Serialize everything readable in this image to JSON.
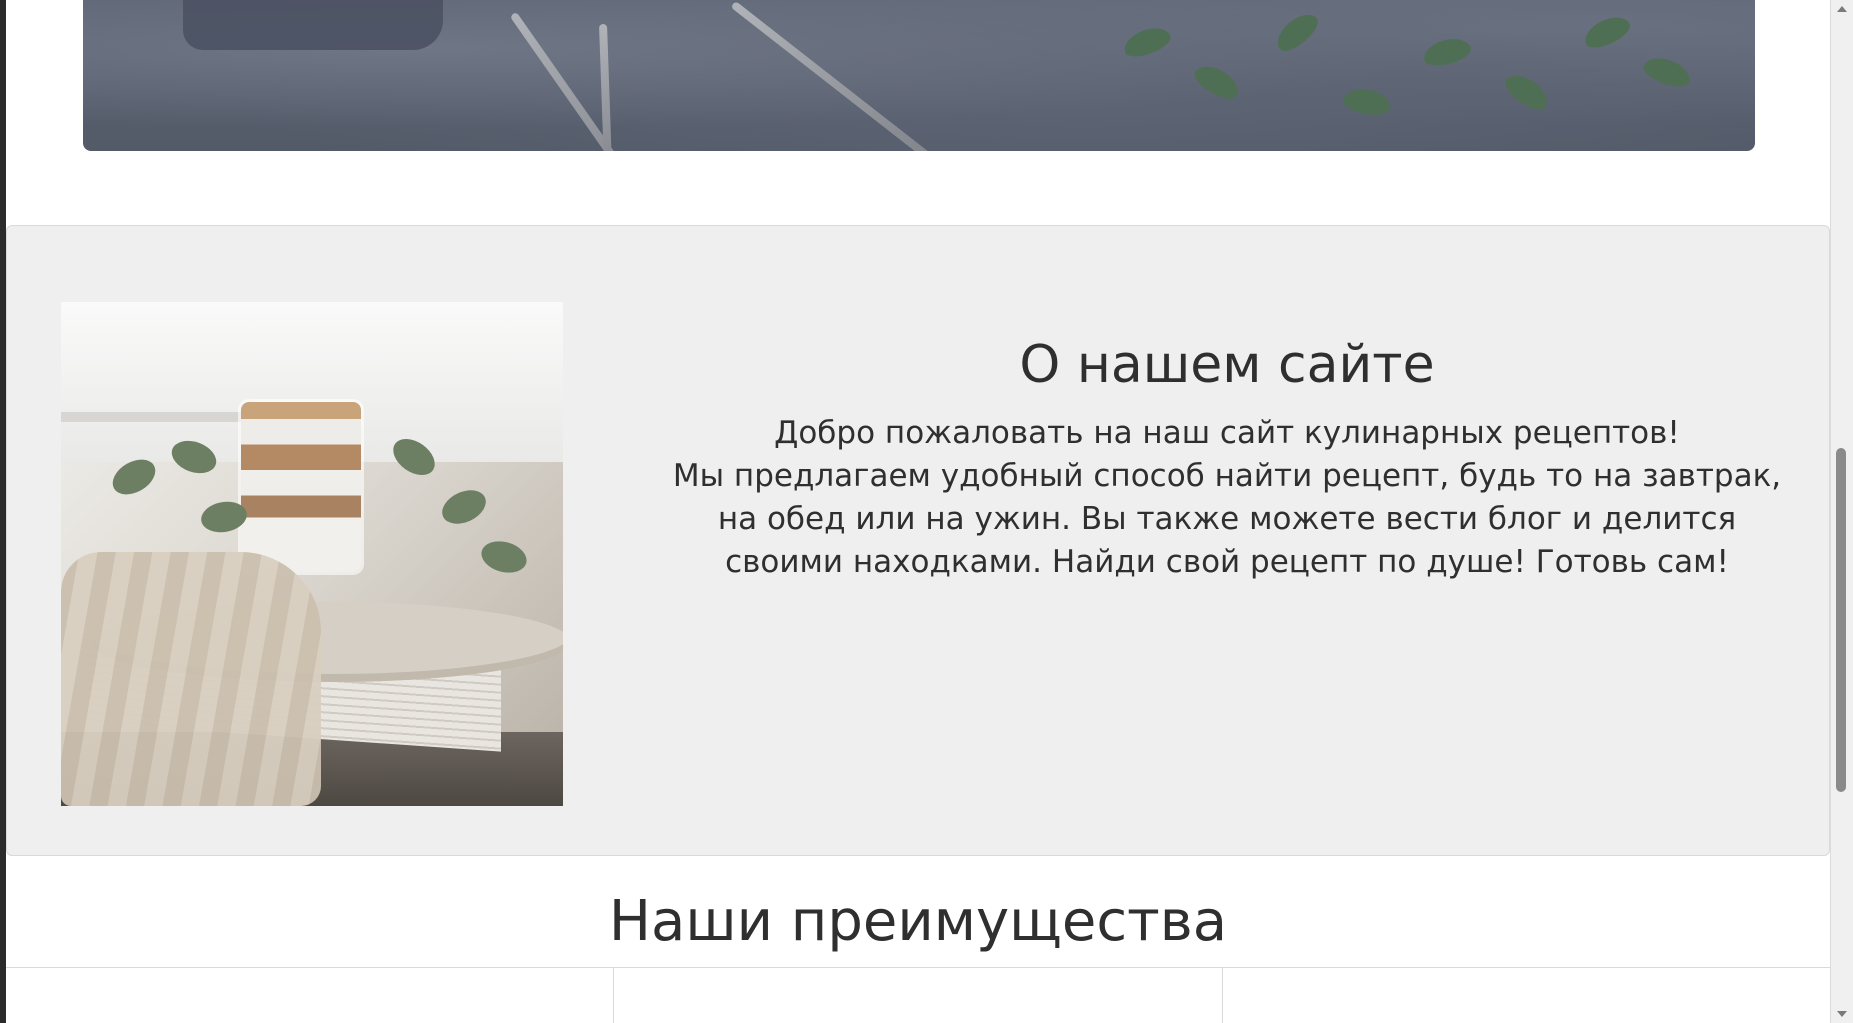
{
  "about": {
    "title": "О нашем сайте",
    "lines": [
      "Добро пожаловать на наш сайт кулинарных рецептов!",
      "Мы предлагаем удобный способ найти рецепт, будь то на завтрак,",
      "на обед или на ужин. Вы также можете вести блог и делится",
      "своими находками. Найди свой рецепт по душе! Готовь сам!"
    ]
  },
  "advantages": {
    "title": "Наши преимущества"
  },
  "colors": {
    "text": "#2f2f2f",
    "section_bg": "#efefef",
    "border": "#d9d9d9"
  },
  "icons": {
    "scroll_up": "chevron-up-icon",
    "scroll_down": "chevron-down-icon"
  }
}
